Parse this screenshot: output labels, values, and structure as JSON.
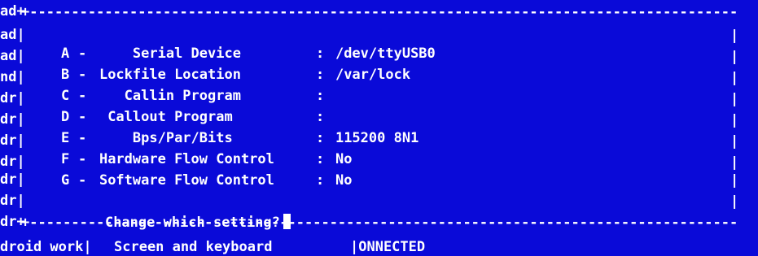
{
  "window": {
    "left_stubs": [
      "ad+",
      "ad|",
      "ad|",
      "nd|",
      "dr|",
      "dr|",
      "dr|",
      "dr|",
      "dr|",
      "dr|",
      "dr+"
    ],
    "border_top": "+-----------------------------------------------------------------------------------------+",
    "border_bottom": "+-----------------------------------------------------------------------------------------+",
    "right_edge": "|"
  },
  "settings": [
    {
      "key": "A",
      "label": "    Serial Device",
      "value": "/dev/ttyUSB0"
    },
    {
      "key": "B",
      "label": "Lockfile Location",
      "value": "/var/lock"
    },
    {
      "key": "C",
      "label": "   Callin Program",
      "value": ""
    },
    {
      "key": "D",
      "label": " Callout Program",
      "value": ""
    },
    {
      "key": "E",
      "label": "    Bps/Par/Bits",
      "value": "115200 8N1"
    },
    {
      "key": "F",
      "label": "Hardware Flow Control",
      "value": "No"
    },
    {
      "key": "G",
      "label": "Software Flow Control",
      "value": "No"
    }
  ],
  "separator": "-",
  "colon": ":",
  "prompt": "Change which setting?",
  "status_bar": {
    "segment1": "droid work|",
    "segment2": "Screen and keyboard",
    "segment3": "|ONNECTED"
  },
  "colors": {
    "background": "#0a0ad8",
    "foreground": "#ffffff"
  }
}
